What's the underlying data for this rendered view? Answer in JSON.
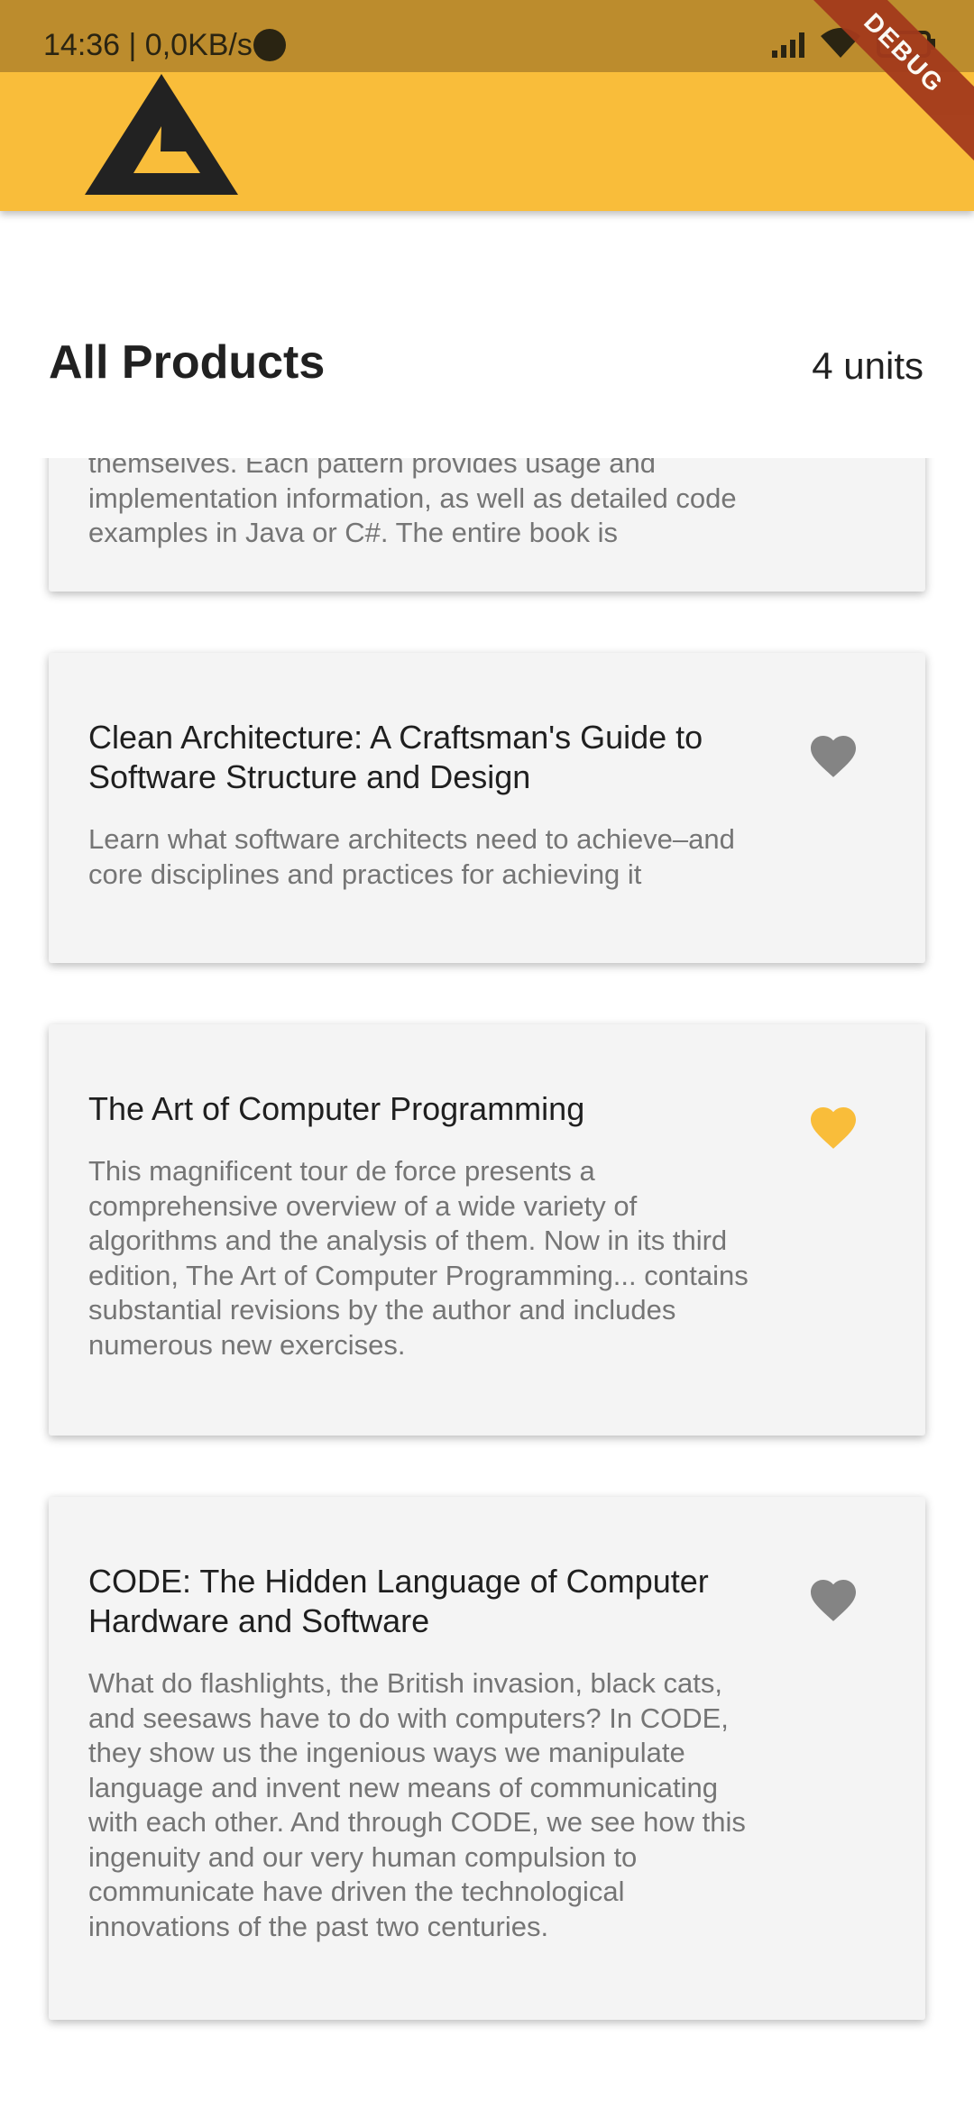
{
  "status_bar": {
    "time": "14:36 | 0,0KB/s",
    "icons": [
      "signal-icon",
      "wifi-icon",
      "battery-icon"
    ]
  },
  "debug_banner": "DEBUG",
  "app_bar": {
    "logo": "app-logo-triangle",
    "color": "#f9bd3a"
  },
  "header": {
    "title": "All Products",
    "count": "4 units"
  },
  "products": [
    {
      "title": "",
      "description": "themselves. Each pattern provides usage and implementation information, as well as detailed code examples in Java or C#. The entire book is",
      "favorite": false
    },
    {
      "title": "Clean Architecture: A Craftsman's Guide to Software Structure and Design",
      "description": "Learn what software architects need to achieve–and core disciplines and practices for achieving it",
      "favorite": false
    },
    {
      "title": "The Art of Computer Programming",
      "description": "This magnificent tour de force presents a comprehensive overview of a wide variety of algorithms and the analysis of them. Now in its third edition, The Art of Computer Programming... contains substantial revisions by the author and includes numerous new exercises.",
      "favorite": true
    },
    {
      "title": "CODE: The Hidden Language of Computer Hardware and Software",
      "description": "What do flashlights, the British invasion, black cats, and seesaws have to do with computers? In CODE, they show us the ingenious ways we manipulate language and invent new means of communicating with each other. And through CODE, we see how this ingenuity and our very human compulsion to communicate have driven the technological innovations of the past two centuries.",
      "favorite": false
    }
  ],
  "colors": {
    "favorite_on": "#f9bd3a",
    "favorite_off": "#848484"
  }
}
